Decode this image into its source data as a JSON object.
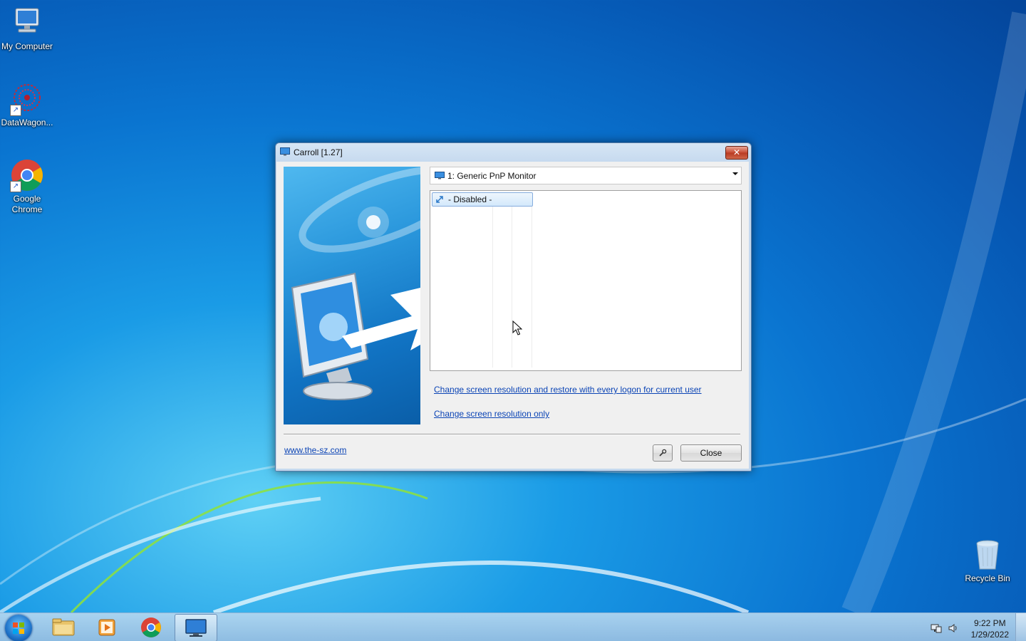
{
  "desktop": {
    "icons": [
      {
        "label": "My Computer"
      },
      {
        "label": "DataWagon..."
      },
      {
        "label": "Google Chrome"
      },
      {
        "label": "Recycle Bin"
      }
    ]
  },
  "window": {
    "title": "Carroll [1.27]",
    "close_glyph": "✕",
    "monitor_select": {
      "value": "1: Generic PnP Monitor"
    },
    "list": {
      "items": [
        {
          "label": "- Disabled -"
        }
      ]
    },
    "links": {
      "restore_every_logon": "Change screen resolution and restore with every logon for current user",
      "change_only": "Change screen resolution only",
      "website": "www.the-sz.com"
    },
    "buttons": {
      "close": "Close"
    }
  },
  "taskbar": {
    "clock": {
      "time": "9:22 PM",
      "date": "1/29/2022"
    }
  },
  "colors": {
    "link": "#0b44b5",
    "desktop_blue": "#0a74d0",
    "close_red": "#c74a32"
  }
}
